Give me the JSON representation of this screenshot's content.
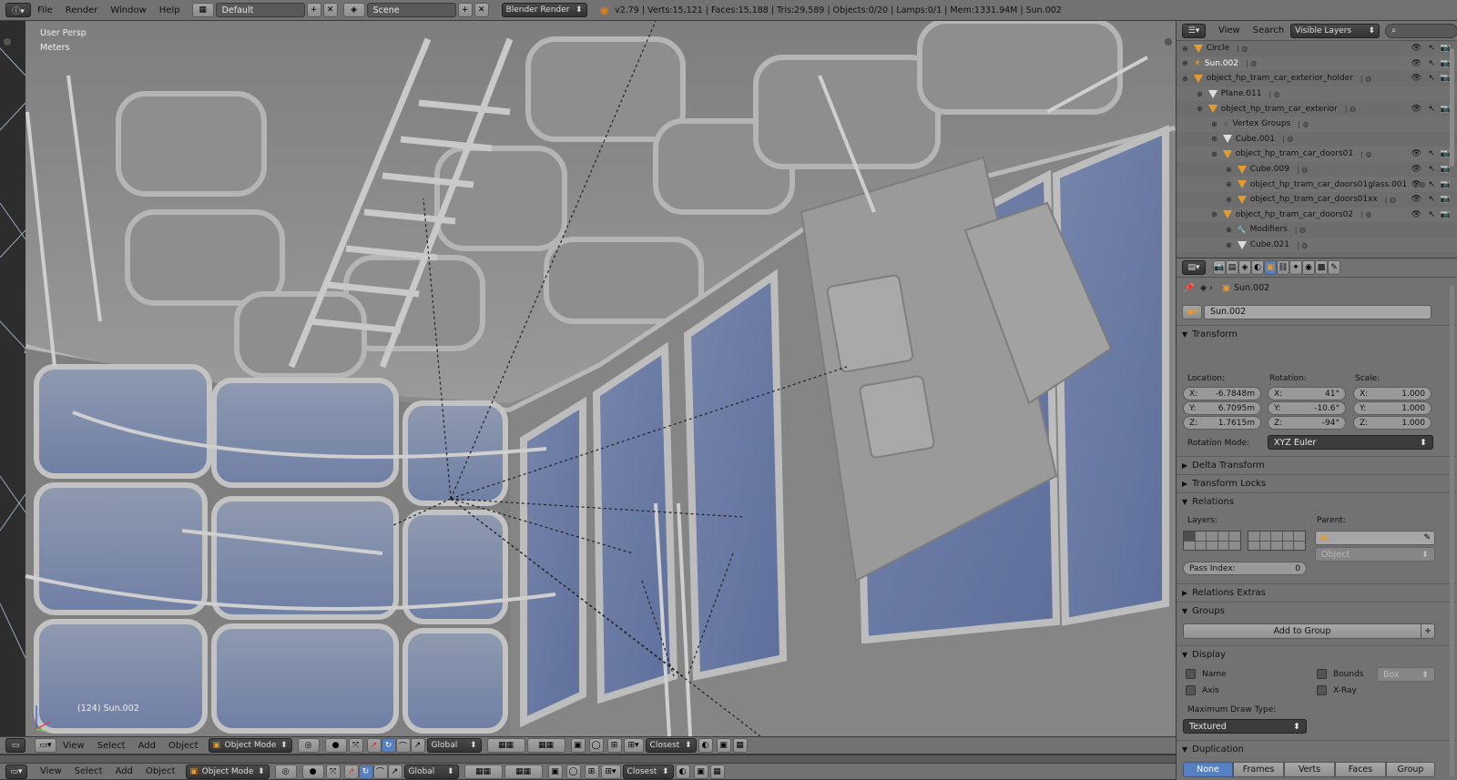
{
  "top_bar": {
    "menus": [
      "File",
      "Render",
      "Window",
      "Help"
    ],
    "layout": "Default",
    "scene": "Scene",
    "engine": "Blender Render",
    "stats": "v2.79 | Verts:15,121 | Faces:15,188 | Tris:29,589 | Objects:0/20 | Lamps:0/1 | Mem:1331.94M | Sun.002"
  },
  "viewport": {
    "view_name": "User Persp",
    "units": "Meters",
    "status": "(124) Sun.002"
  },
  "view_header": {
    "menus": [
      "View",
      "Select",
      "Add",
      "Object"
    ],
    "mode": "Object Mode",
    "orientation": "Global",
    "snap": "Closest"
  },
  "bottom_header": {
    "menus": [
      "View",
      "Select",
      "Add",
      "Object"
    ],
    "mode": "Object Mode",
    "orientation": "Global",
    "snap": "Closest"
  },
  "outliner": {
    "menus": [
      "View",
      "Search"
    ],
    "filter": "Visible Layers",
    "rows": [
      {
        "label": "Circle",
        "indent": 0
      },
      {
        "label": "Sun.002",
        "indent": 0
      },
      {
        "label": "object_hp_tram_car_exterior_holder",
        "indent": 0
      },
      {
        "label": "Plane.011",
        "indent": 1
      },
      {
        "label": "object_hp_tram_car_exterior",
        "indent": 1
      },
      {
        "label": "Vertex Groups",
        "indent": 2
      },
      {
        "label": "Cube.001",
        "indent": 2
      },
      {
        "label": "object_hp_tram_car_doors01",
        "indent": 2
      },
      {
        "label": "Cube.009",
        "indent": 3
      },
      {
        "label": "object_hp_tram_car_doors01glass.001",
        "indent": 3
      },
      {
        "label": "object_hp_tram_car_doors01xx",
        "indent": 3
      },
      {
        "label": "object_hp_tram_car_doors02",
        "indent": 2
      },
      {
        "label": "Modifiers",
        "indent": 3
      },
      {
        "label": "Cube.021",
        "indent": 3
      }
    ]
  },
  "properties": {
    "breadcrumb": "Sun.002",
    "object_name": "Sun.002",
    "transform": {
      "title": "Transform",
      "location_label": "Location:",
      "rotation_label": "Rotation:",
      "scale_label": "Scale:",
      "location": [
        {
          "axis": "X:",
          "value": "-6.7848m"
        },
        {
          "axis": "Y:",
          "value": "6.7095m"
        },
        {
          "axis": "Z:",
          "value": "1.7615m"
        }
      ],
      "rotation": [
        {
          "axis": "X:",
          "value": "41°"
        },
        {
          "axis": "Y:",
          "value": "-10.6°"
        },
        {
          "axis": "Z:",
          "value": "-94°"
        }
      ],
      "scale": [
        {
          "axis": "X:",
          "value": "1.000"
        },
        {
          "axis": "Y:",
          "value": "1.000"
        },
        {
          "axis": "Z:",
          "value": "1.000"
        }
      ],
      "rotation_mode_label": "Rotation Mode:",
      "rotation_mode": "XYZ Euler"
    },
    "delta_transform": "Delta Transform",
    "transform_locks": "Transform Locks",
    "relations": {
      "title": "Relations",
      "layers_label": "Layers:",
      "parent_label": "Parent:",
      "parent_type": "Object",
      "pass_index_label": "Pass Index:",
      "pass_index": "0"
    },
    "relations_extras": "Relations Extras",
    "groups": {
      "title": "Groups",
      "add_button": "Add to Group"
    },
    "display": {
      "title": "Display",
      "name": "Name",
      "axis": "Axis",
      "bounds": "Bounds",
      "bounds_type": "Box",
      "xray": "X-Ray",
      "max_draw_label": "Maximum Draw Type:",
      "max_draw": "Textured"
    },
    "duplication": {
      "title": "Duplication",
      "tabs": [
        "None",
        "Frames",
        "Verts",
        "Faces",
        "Group"
      ]
    }
  },
  "colors": {
    "accent_blue": "#5680c2",
    "object_orange": "#e59a2e",
    "panel_gray": "#727272"
  }
}
